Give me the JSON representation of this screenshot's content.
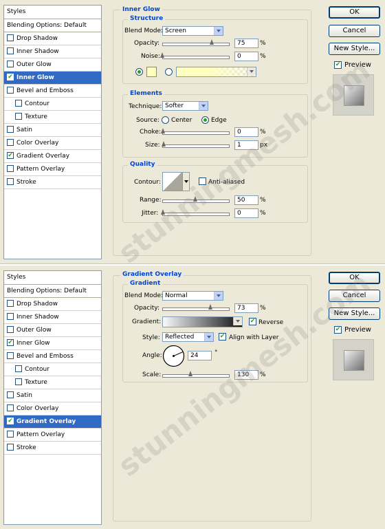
{
  "top": {
    "styles_header": "Styles",
    "blending_options": "Blending Options: Default",
    "items": [
      {
        "label": "Drop Shadow",
        "checked": false
      },
      {
        "label": "Inner Shadow",
        "checked": false
      },
      {
        "label": "Outer Glow",
        "checked": false
      },
      {
        "label": "Inner Glow",
        "checked": true,
        "selected": true
      },
      {
        "label": "Bevel and Emboss",
        "checked": false
      },
      {
        "label": "Contour",
        "checked": false,
        "indent": true
      },
      {
        "label": "Texture",
        "checked": false,
        "indent": true
      },
      {
        "label": "Satin",
        "checked": false
      },
      {
        "label": "Color Overlay",
        "checked": false
      },
      {
        "label": "Gradient Overlay",
        "checked": true
      },
      {
        "label": "Pattern Overlay",
        "checked": false
      },
      {
        "label": "Stroke",
        "checked": false
      }
    ],
    "section_title": "Inner Glow",
    "structure_title": "Structure",
    "blend_mode_label": "Blend Mode:",
    "blend_mode_value": "Screen",
    "opacity_label": "Opacity:",
    "opacity_value": "75",
    "opacity_unit": "%",
    "opacity_level": 0.75,
    "noise_label": "Noise:",
    "noise_value": "0",
    "noise_unit": "%",
    "noise_level": 0,
    "elements_title": "Elements",
    "technique_label": "Technique:",
    "technique_value": "Softer",
    "source_label": "Source:",
    "source_center": "Center",
    "source_edge": "Edge",
    "choke_label": "Choke:",
    "choke_value": "0",
    "choke_unit": "%",
    "size_label": "Size:",
    "size_value": "1",
    "size_unit": "px",
    "quality_title": "Quality",
    "contour_label": "Contour:",
    "anti_aliased_label": "Anti-aliased",
    "range_label": "Range:",
    "range_value": "50",
    "range_unit": "%",
    "range_level": 0.5,
    "jitter_label": "Jitter:",
    "jitter_value": "0",
    "jitter_unit": "%",
    "glow_color": "#ffffc0",
    "buttons": {
      "ok": "OK",
      "cancel": "Cancel",
      "new_style": "New Style...",
      "preview": "Preview"
    }
  },
  "bottom": {
    "styles_header": "Styles",
    "blending_options": "Blending Options: Default",
    "items": [
      {
        "label": "Drop Shadow",
        "checked": false
      },
      {
        "label": "Inner Shadow",
        "checked": false
      },
      {
        "label": "Outer Glow",
        "checked": false
      },
      {
        "label": "Inner Glow",
        "checked": true
      },
      {
        "label": "Bevel and Emboss",
        "checked": false
      },
      {
        "label": "Contour",
        "checked": false,
        "indent": true
      },
      {
        "label": "Texture",
        "checked": false,
        "indent": true
      },
      {
        "label": "Satin",
        "checked": false
      },
      {
        "label": "Color Overlay",
        "checked": false
      },
      {
        "label": "Gradient Overlay",
        "checked": true,
        "selected": true
      },
      {
        "label": "Pattern Overlay",
        "checked": false
      },
      {
        "label": "Stroke",
        "checked": false
      }
    ],
    "section_title": "Gradient Overlay",
    "gradient_title": "Gradient",
    "blend_mode_label": "Blend Mode:",
    "blend_mode_value": "Normal",
    "opacity_label": "Opacity:",
    "opacity_value": "73",
    "opacity_unit": "%",
    "opacity_level": 0.73,
    "gradient_label": "Gradient:",
    "reverse_label": "Reverse",
    "style_label": "Style:",
    "style_value": "Reflected",
    "align_label": "Align with Layer",
    "angle_label": "Angle:",
    "angle_value": "24",
    "angle_unit": "°",
    "scale_label": "Scale:",
    "scale_value": "130",
    "scale_unit": "%",
    "scale_level": 0.43,
    "buttons": {
      "ok": "OK",
      "cancel": "Cancel",
      "new_style": "New Style...",
      "preview": "Preview"
    }
  },
  "watermark": "stunningmesh.com"
}
